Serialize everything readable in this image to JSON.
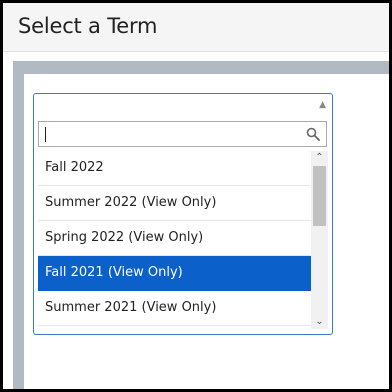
{
  "header": {
    "title": "Select a Term"
  },
  "term_select": {
    "search_value": "",
    "options": [
      {
        "label": "Fall 2022",
        "selected": false
      },
      {
        "label": "Summer 2022 (View Only)",
        "selected": false
      },
      {
        "label": "Spring 2022 (View Only)",
        "selected": false
      },
      {
        "label": "Fall 2021 (View Only)",
        "selected": true
      },
      {
        "label": "Summer 2021 (View Only)",
        "selected": false
      }
    ]
  },
  "colors": {
    "accent": "#0b61c9",
    "select_border": "#3a7bc8",
    "band": "#b1bac3"
  },
  "icons": {
    "search": "magnifier-icon",
    "dropdown": "up-arrow-icon"
  }
}
